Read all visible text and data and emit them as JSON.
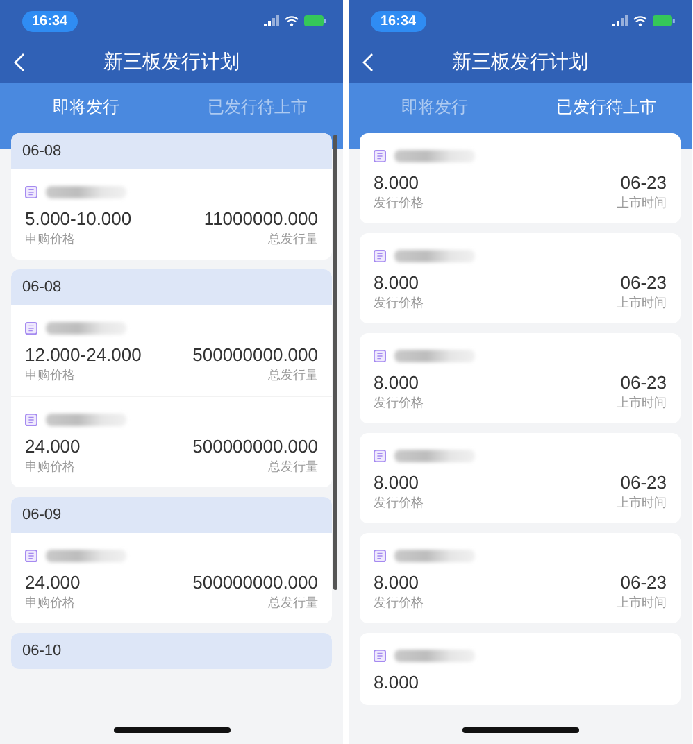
{
  "screens": [
    {
      "kind": "grouped",
      "status_bar": {
        "time": "16:34"
      },
      "title": "新三板发行计划",
      "tabs": [
        {
          "label": "即将发行",
          "selected": true
        },
        {
          "label": "已发行待上市",
          "selected": false
        }
      ],
      "groups": [
        {
          "date": "06-08",
          "items": [
            {
              "left_value": "5.000-10.000",
              "left_label": "申购价格",
              "right_value": "11000000.000",
              "right_label": "总发行量"
            }
          ]
        },
        {
          "date": "06-08",
          "items": [
            {
              "left_value": "12.000-24.000",
              "left_label": "申购价格",
              "right_value": "500000000.000",
              "right_label": "总发行量"
            },
            {
              "left_value": "24.000",
              "left_label": "申购价格",
              "right_value": "500000000.000",
              "right_label": "总发行量"
            }
          ]
        },
        {
          "date": "06-09",
          "items": [
            {
              "left_value": "24.000",
              "left_label": "申购价格",
              "right_value": "500000000.000",
              "right_label": "总发行量"
            }
          ]
        },
        {
          "date": "06-10"
        }
      ]
    },
    {
      "kind": "cards",
      "status_bar": {
        "time": "16:34"
      },
      "title": "新三板发行计划",
      "tabs": [
        {
          "label": "即将发行",
          "selected": false
        },
        {
          "label": "已发行待上市",
          "selected": true
        }
      ],
      "items": [
        {
          "left_value": "8.000",
          "left_label": "发行价格",
          "right_value": "06-23",
          "right_label": "上市时间"
        },
        {
          "left_value": "8.000",
          "left_label": "发行价格",
          "right_value": "06-23",
          "right_label": "上市时间"
        },
        {
          "left_value": "8.000",
          "left_label": "发行价格",
          "right_value": "06-23",
          "right_label": "上市时间"
        },
        {
          "left_value": "8.000",
          "left_label": "发行价格",
          "right_value": "06-23",
          "right_label": "上市时间"
        },
        {
          "left_value": "8.000",
          "left_label": "发行价格",
          "right_value": "06-23",
          "right_label": "上市时间"
        },
        {
          "left_value": "8.000"
        }
      ]
    }
  ]
}
